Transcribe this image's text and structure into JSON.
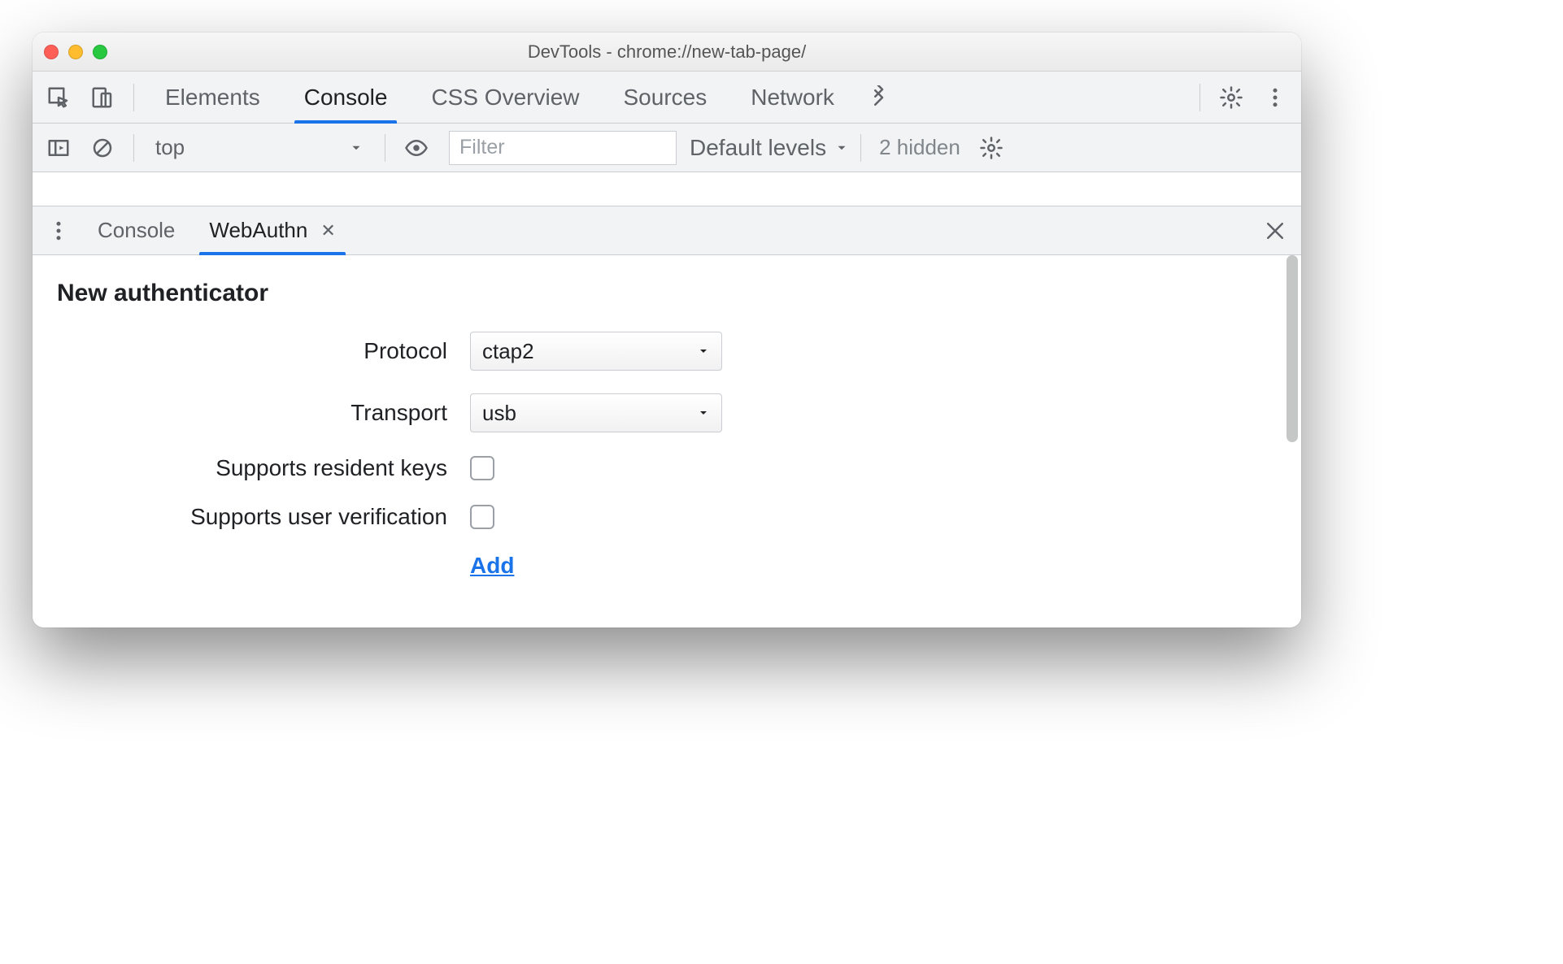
{
  "window": {
    "title": "DevTools - chrome://new-tab-page/"
  },
  "topTabs": {
    "elements": "Elements",
    "console": "Console",
    "cssOverview": "CSS Overview",
    "sources": "Sources",
    "network": "Network"
  },
  "consoleBar": {
    "context": "top",
    "filterPlaceholder": "Filter",
    "levels": "Default levels",
    "hidden": "2 hidden"
  },
  "drawer": {
    "console": "Console",
    "webauthn": "WebAuthn"
  },
  "webauthn": {
    "heading": "New authenticator",
    "protocolLabel": "Protocol",
    "protocolValue": "ctap2",
    "transportLabel": "Transport",
    "transportValue": "usb",
    "residentKeysLabel": "Supports resident keys",
    "userVerificationLabel": "Supports user verification",
    "addLabel": "Add"
  }
}
